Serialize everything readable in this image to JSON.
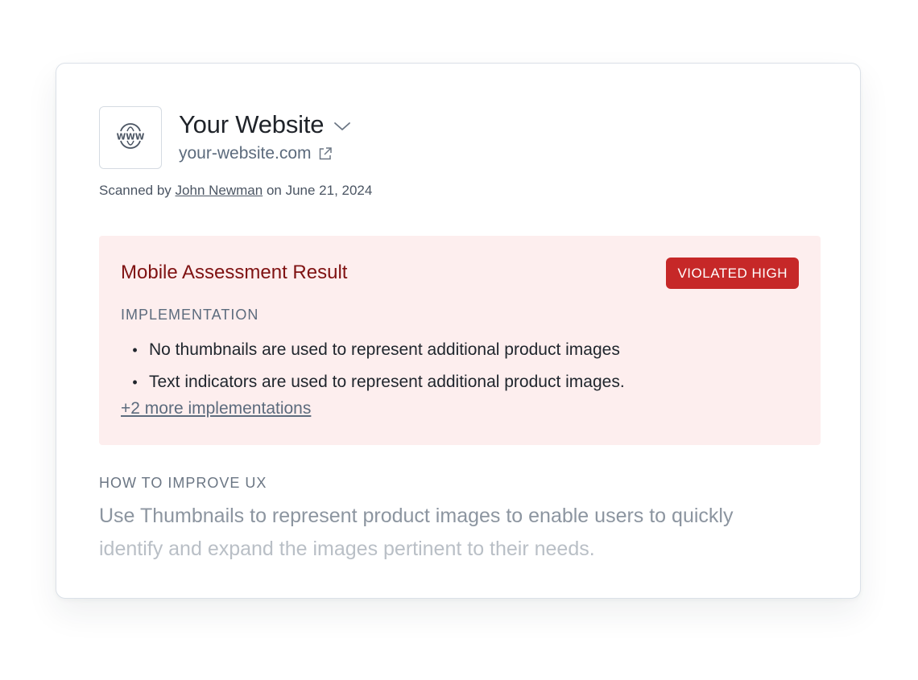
{
  "site": {
    "name": "Your Website",
    "url": "your-website.com",
    "icon": "globe-www-icon"
  },
  "scan": {
    "prefix": "Scanned by",
    "user": "John Newman",
    "date_text": "on June 21, 2024"
  },
  "assessment": {
    "title": "Mobile Assessment Result",
    "badge": "VIOLATED HIGH",
    "section_label": "IMPLEMENTATION",
    "items": [
      "No thumbnails are used to represent additional product images",
      "Text indicators are used to represent additional product images."
    ],
    "more_link": "+2 more implementations"
  },
  "improve": {
    "label": "HOW TO IMPROVE UX",
    "line1": "Use Thumbnails to represent product images to enable users to quickly",
    "line2": "identify and expand the images pertinent to their needs."
  },
  "colors": {
    "badge_bg": "#c62828",
    "panel_bg": "#fdeeee",
    "title_red": "#7f1212"
  }
}
